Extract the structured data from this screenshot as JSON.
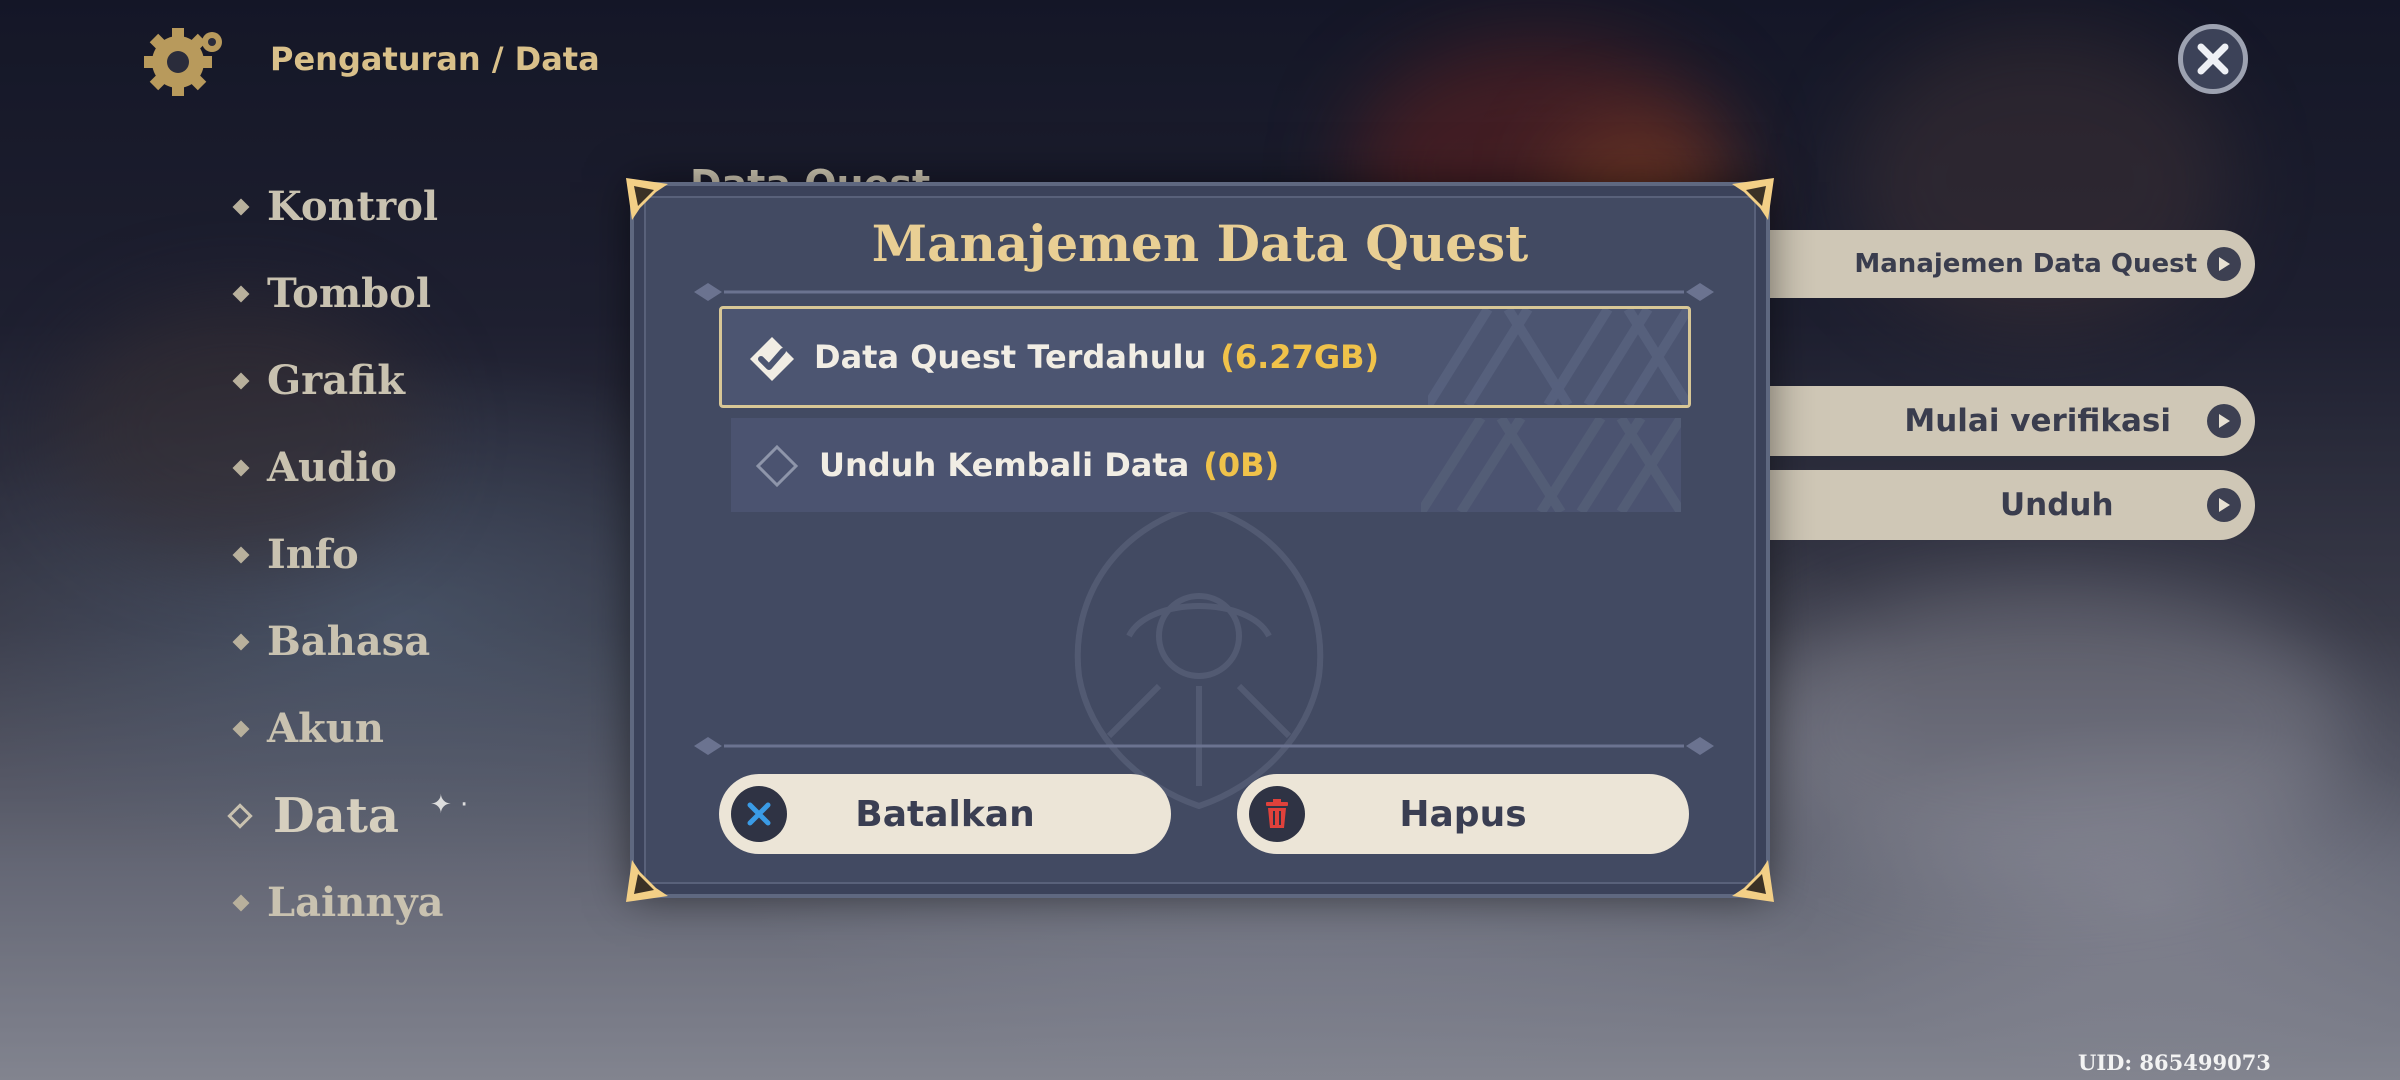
{
  "header": {
    "breadcrumb": "Pengaturan / Data",
    "icon": "gear-icon",
    "close_icon": "close-icon"
  },
  "sidebar": {
    "items": [
      {
        "label": "Kontrol"
      },
      {
        "label": "Tombol"
      },
      {
        "label": "Grafik"
      },
      {
        "label": "Audio"
      },
      {
        "label": "Info"
      },
      {
        "label": "Bahasa"
      },
      {
        "label": "Akun"
      },
      {
        "label": "Data",
        "active": true
      },
      {
        "label": "Lainnya"
      }
    ]
  },
  "background_panel": {
    "section_title": "Data Quest",
    "buttons": [
      {
        "label": "Manajemen Data Quest"
      },
      {
        "label": "Mulai verifikasi"
      },
      {
        "label": "Unduh"
      }
    ]
  },
  "dialog": {
    "title": "Manajemen Data Quest",
    "options": [
      {
        "name": "Data Quest Terdahulu",
        "size": "(6.27GB)",
        "selected": true
      },
      {
        "name": "Unduh Kembali Data",
        "size": "(0B)",
        "selected": false
      }
    ],
    "cancel_label": "Batalkan",
    "delete_label": "Hapus"
  },
  "footer": {
    "uid": "UID: 865499073"
  },
  "colors": {
    "accent_gold": "#e9cf94",
    "size_yellow": "#f0c24a",
    "dialog_bg": "#424a62",
    "button_bg": "#ece5d7",
    "cancel_icon": "#3a9be6",
    "delete_icon": "#e0413b"
  }
}
